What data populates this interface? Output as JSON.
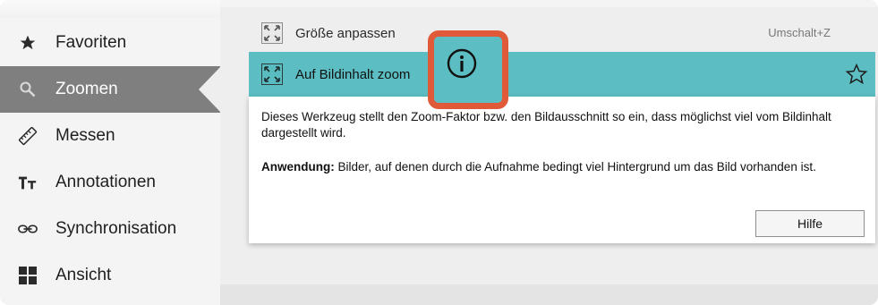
{
  "sidebar": {
    "items": [
      {
        "label": "Favoriten",
        "icon": "star-icon"
      },
      {
        "label": "Zoomen",
        "icon": "zoom-search-icon",
        "active": true
      },
      {
        "label": "Messen",
        "icon": "ruler-icon"
      },
      {
        "label": "Annotationen",
        "icon": "text-size-icon"
      },
      {
        "label": "Synchronisation",
        "icon": "link-chain-icon"
      },
      {
        "label": "Ansicht",
        "icon": "grid-layout-icon"
      }
    ]
  },
  "tools": {
    "fit": {
      "label": "Größe anpassen",
      "shortcut": "Umschalt+Z",
      "icon": "fit-size-icon"
    },
    "zoom_content": {
      "label": "Auf Bildinhalt zoom",
      "icon": "zoom-content-icon"
    }
  },
  "info_panel": {
    "description": "Dieses Werkzeug stellt den Zoom-Faktor bzw. den Bildausschnitt so ein, dass möglichst viel vom Bildinhalt dargestellt wird.",
    "usage_label": "Anwendung:",
    "usage_text": " Bilder, auf denen durch die Aufnahme bedingt viel Hintergrund um das Bild vorhanden ist.",
    "help_button": "Hilfe"
  },
  "colors": {
    "accent": "#5cbec3",
    "highlight": "#e05a3a",
    "active_nav": "#7f7f7f"
  }
}
